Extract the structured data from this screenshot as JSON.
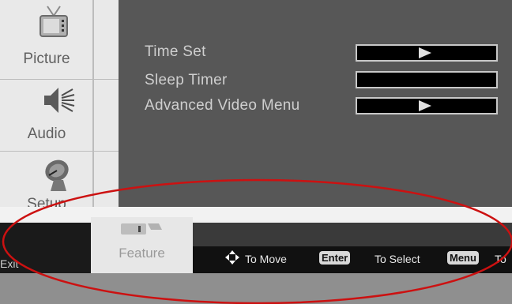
{
  "sidebar": {
    "items": [
      {
        "label": "Picture",
        "icon": "tv-icon"
      },
      {
        "label": "Audio",
        "icon": "speaker-icon"
      },
      {
        "label": "Setup",
        "icon": "satellite-dish-icon"
      }
    ]
  },
  "menu": {
    "items": [
      {
        "label": "Time Set",
        "control": "arrow-bar"
      },
      {
        "label": "Sleep Timer",
        "control": "bar"
      },
      {
        "label": "Advanced Video Menu",
        "control": "arrow-bar"
      }
    ]
  },
  "bottom": {
    "exit_label": "Exit",
    "feature_tab": {
      "label": "Feature",
      "icon": "feature-icon"
    },
    "hints": {
      "move_label": "To Move",
      "enter_key": "Enter",
      "select_label": "To Select",
      "menu_key": "Menu",
      "menu_trail": "To"
    }
  },
  "colors": {
    "sidebar_bg": "#e9e9e9",
    "menu_bg": "#575757",
    "menu_text": "#cfcfcf",
    "highlight_ellipse": "#cc1111"
  }
}
